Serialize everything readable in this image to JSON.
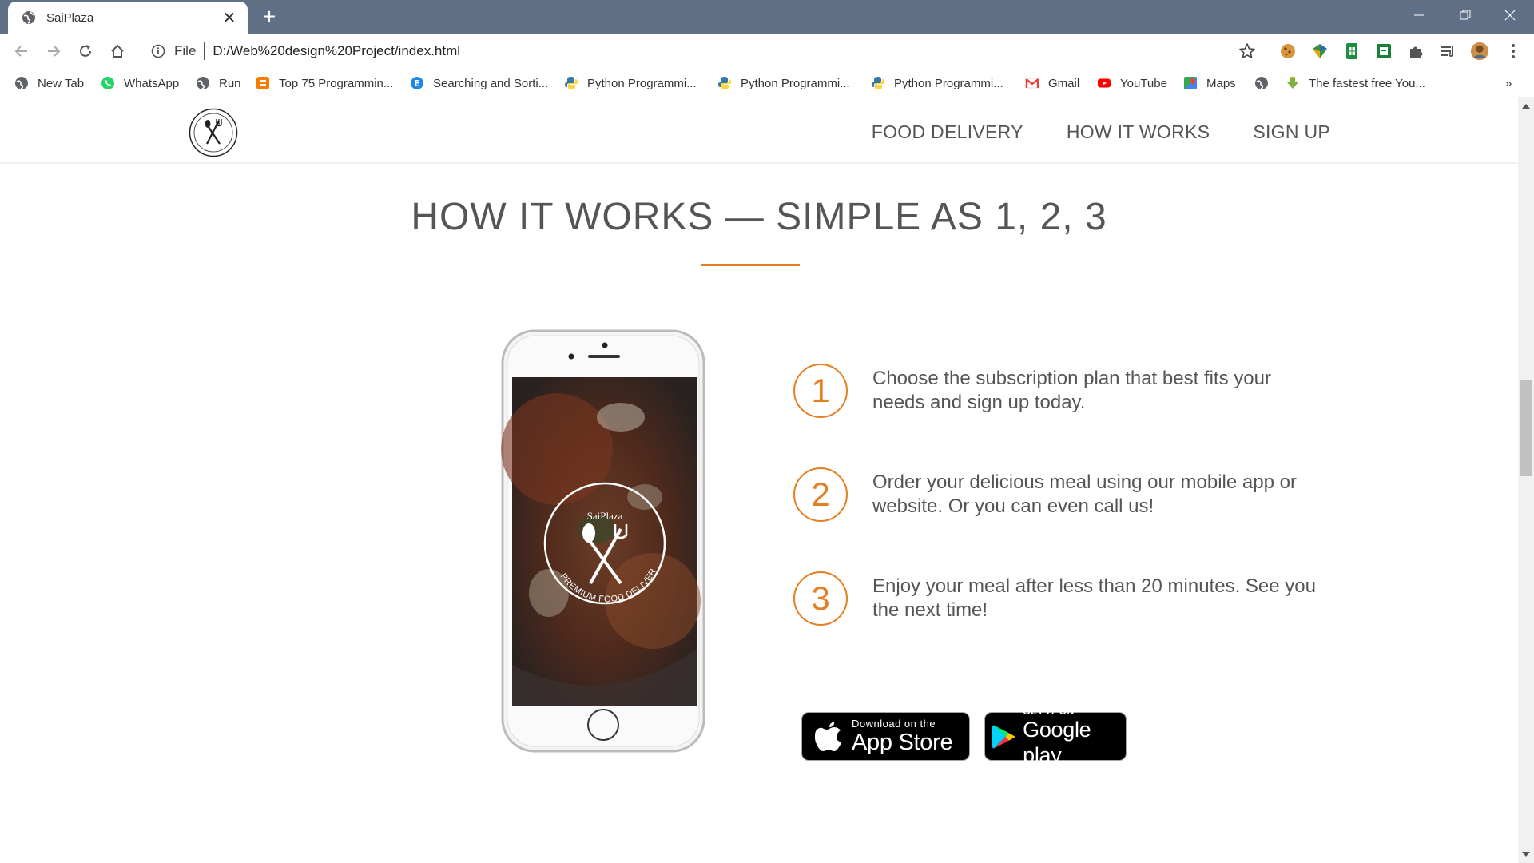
{
  "browser": {
    "tab_title": "SaiPlaza",
    "tab_close": "✕",
    "new_tab": "+",
    "omnibox_scheme": "File",
    "url": "D:/Web%20design%20Project/index.html",
    "bookmarks": [
      {
        "label": "New Tab",
        "icon": "globe-icon"
      },
      {
        "label": "WhatsApp",
        "icon": "whatsapp-icon"
      },
      {
        "label": "Run",
        "icon": "globe-icon"
      },
      {
        "label": "Top 75 Programmin...",
        "icon": "blogger-icon"
      },
      {
        "label": "Searching and Sorti...",
        "icon": "e-icon"
      },
      {
        "label": "Python Programmi...",
        "icon": "python-icon"
      },
      {
        "label": "Python Programmi...",
        "icon": "python-icon"
      },
      {
        "label": "Python Programmi...",
        "icon": "python-icon"
      },
      {
        "label": "Gmail",
        "icon": "gmail-icon"
      },
      {
        "label": "YouTube",
        "icon": "youtube-icon"
      },
      {
        "label": "Maps",
        "icon": "maps-icon"
      },
      {
        "label": "",
        "icon": "globe-icon"
      },
      {
        "label": "The fastest free You...",
        "icon": "download-icon"
      }
    ],
    "more_bookmarks": "»"
  },
  "site": {
    "nav": {
      "links": [
        "FOOD DELIVERY",
        "HOW IT WORKS",
        "SIGN UP"
      ]
    },
    "section": {
      "title": "HOW IT WORKS — SIMPLE AS 1, 2, 3",
      "steps": [
        {
          "number": "1",
          "text": "Choose the subscription plan that best fits your needs and sign up today."
        },
        {
          "number": "2",
          "text": "Order your delicious meal using our mobile app or website. Or you can even call us!"
        },
        {
          "number": "3",
          "text": "Enjoy your meal after less than 20 minutes. See you the next time!"
        }
      ],
      "phone_logo_name": "SaiPlaza",
      "phone_logo_tagline": "PREMIUM FOOD DELIVERY",
      "app_store": {
        "small": "Download on the",
        "big": "App Store"
      },
      "google_play": {
        "small": "GET IT ON",
        "big": "Google play"
      }
    }
  },
  "colors": {
    "accent": "#e67e22",
    "tabstrip": "#5f6f86"
  }
}
